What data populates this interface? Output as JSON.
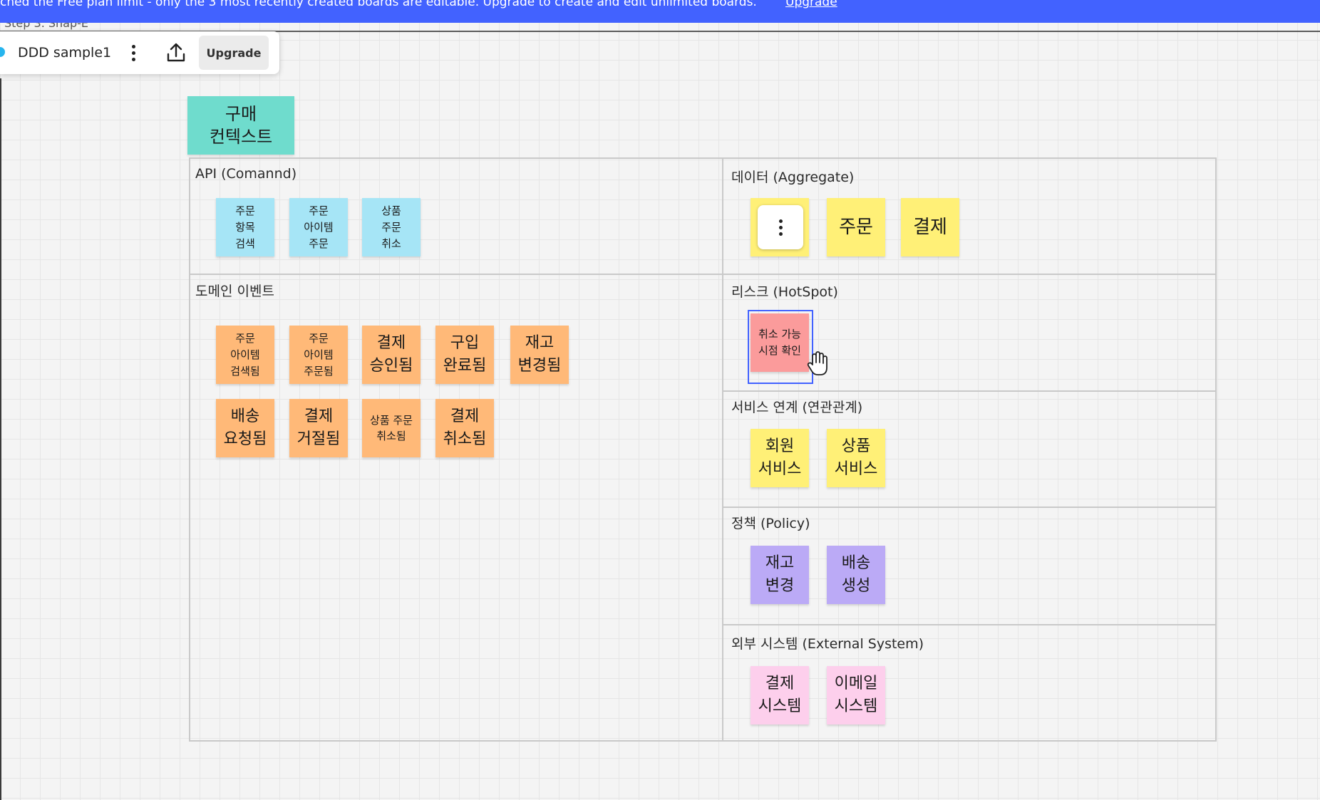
{
  "banner": {
    "message": "ched the Free plan limit - only the 3 most recently created boards are editable. Upgrade to create and edit unlimited boards.",
    "link": "Upgrade"
  },
  "breadcrumb": "Step 3. Snap-E",
  "toolbar": {
    "board_name": "DDD sample1",
    "upgrade_label": "Upgrade",
    "icons": [
      "more-vertical-icon",
      "export-icon"
    ]
  },
  "context_note": "구매\n컨텍스트",
  "sections": {
    "api": {
      "label": "API (Comannd)",
      "notes": [
        "주문\n항목\n검색",
        "주문\n아이템\n주문",
        "상품\n주문\n취소"
      ]
    },
    "domain_events": {
      "label": "도메인 이벤트",
      "notes": [
        "주문\n아이템\n검색됨",
        "주문\n아이템\n주문됨",
        "결제\n승인됨",
        "구입\n완료됨",
        "재고\n변경됨",
        "배송\n요청됨",
        "결제\n거절됨",
        "상품 주문\n취소됨",
        "결제\n취소됨"
      ]
    },
    "aggregate": {
      "label": "데이터 (Aggregate)",
      "notes": [
        "",
        "주문",
        "결제"
      ]
    },
    "hotspot": {
      "label": "리스크 (HotSpot)",
      "notes": [
        "취소 가능\n시점 확인"
      ]
    },
    "services": {
      "label": "서비스 연계 (연관관계)",
      "notes": [
        "회원\n서비스",
        "상품\n서비스"
      ]
    },
    "policy": {
      "label": "정책 (Policy)",
      "notes": [
        "재고\n변경",
        "배송\n생성"
      ]
    },
    "external": {
      "label": "외부 시스템 (External System)",
      "notes": [
        "결제\n시스템",
        "이메일\n시스템"
      ]
    }
  },
  "colors": {
    "banner": "#4262ff",
    "command": "#a6e5f6",
    "event": "#ffb978",
    "aggregate": "#fff077",
    "hotspot": "#fb9b9b",
    "policy": "#bbaaf6",
    "external": "#fdcfec",
    "context": "#6fdccd"
  }
}
